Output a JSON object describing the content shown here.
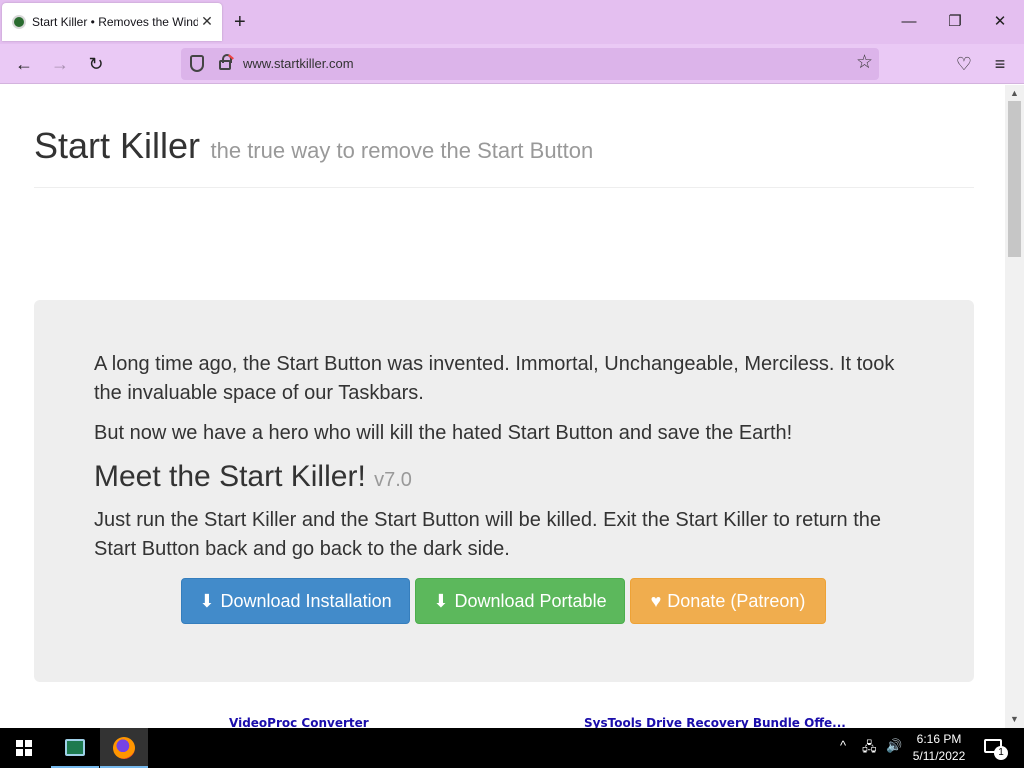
{
  "browser": {
    "tab_title": "Start Killer • Removes the Windows Start Button",
    "url": "www.startkiller.com",
    "controls": {
      "tab_close": "✕",
      "new_tab": "+",
      "back": "←",
      "forward": "→",
      "reload": "↻",
      "star": "☆",
      "pocket": "♡",
      "menu": "≡",
      "minimize": "—",
      "restore": "❐",
      "close": "✕"
    }
  },
  "page": {
    "title": "Start Killer",
    "subtitle": "the true way to remove the Start Button",
    "intro_1": "A long time ago, the Start Button was invented. Immortal, Unchangeable, Merciless. It took the invaluable space of our Taskbars.",
    "intro_2": "But now we have a hero who will kill the hated Start Button and save the Earth!",
    "heading": "Meet the Start Killer!",
    "version": "v7.0",
    "description": "Just run the Start Killer and the Start Button will be killed. Exit the Start Killer to return the Start Button back and go back to the dark side.",
    "buttons": {
      "install": "Download Installation",
      "portable": "Download Portable",
      "donate": "Donate (Patreon)"
    },
    "icons": {
      "download": "⬇",
      "heart": "♥"
    },
    "ads": {
      "left": "VideoProc Converter",
      "right": "SysTools Drive Recovery Bundle Offe..."
    }
  },
  "taskbar": {
    "time": "6:16 PM",
    "date": "5/11/2022",
    "notification_count": "1",
    "tray": {
      "chevron": "^",
      "volume": "🔊"
    }
  },
  "colors": {
    "install_button": "#428bca",
    "portable_button": "#5cb85c",
    "donate_button": "#f0ad4e",
    "tabbar": "#e4bff0",
    "jumbotron": "#eeeeee"
  }
}
